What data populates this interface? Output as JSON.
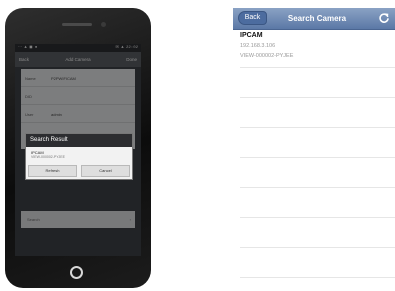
{
  "android": {
    "status": {
      "left": "⋯ ▲ ◼ ●",
      "right": "✉ ▲ 22:02"
    },
    "title_bar": {
      "back": "Back",
      "title": "Add Camera",
      "done": "Done"
    },
    "form": {
      "rows": [
        {
          "label": "Name",
          "value": "P2PWIFICAM"
        },
        {
          "label": "DID",
          "value": ""
        },
        {
          "label": "User",
          "value": "admin"
        }
      ]
    },
    "search_row": "Search",
    "dialog": {
      "title": "Search Result",
      "item_name": "IPCAM",
      "item_id": "VIEW-000002-PYJEE",
      "refresh": "Refresh",
      "cancel": "Cancel"
    }
  },
  "ios": {
    "nav": {
      "back": "Back",
      "title": "Search Camera"
    },
    "camera": {
      "name": "IPCAM",
      "ip": "192.168.3.106",
      "id": "VIEW-000002-PYJEE"
    },
    "colors": {
      "nav_top": "#8aa2c4",
      "nav_bottom": "#5b78a6",
      "back_button": "#4c6c9f"
    }
  }
}
